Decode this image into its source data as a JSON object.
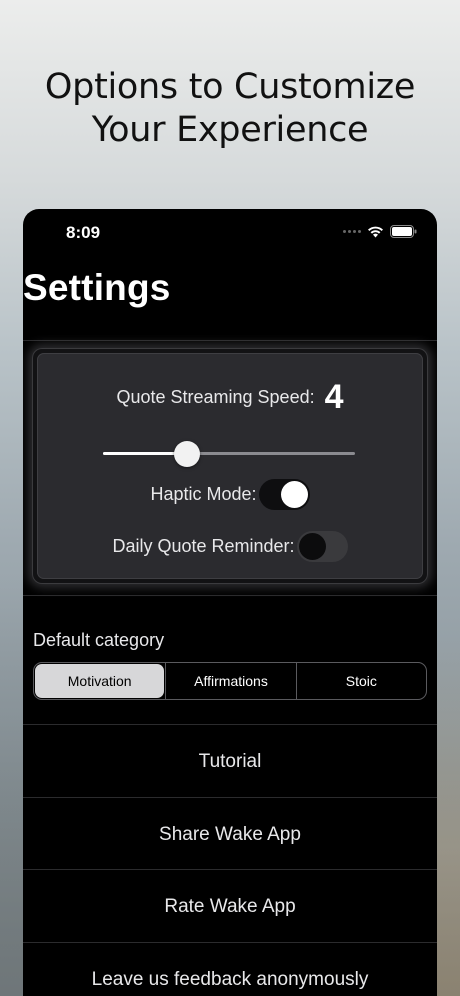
{
  "headline": {
    "line1": "Options to Customize",
    "line2": "Your Experience"
  },
  "status_bar": {
    "time": "8:09",
    "icons": [
      "signal-icon",
      "wifi-icon",
      "battery-icon"
    ]
  },
  "screen": {
    "title": "Settings"
  },
  "panel": {
    "speed_label": "Quote Streaming Speed:",
    "speed_value": "4",
    "speed_slider": {
      "min": 1,
      "max": 10,
      "value": 4
    },
    "haptic_label": "Haptic Mode:",
    "haptic_on": true,
    "reminder_label": "Daily Quote Reminder:",
    "reminder_on": false
  },
  "category": {
    "label": "Default category",
    "options": [
      "Motivation",
      "Affirmations",
      "Stoic"
    ],
    "selected": "Motivation"
  },
  "menu": {
    "tutorial": "Tutorial",
    "share": "Share Wake App",
    "rate": "Rate Wake App",
    "feedback": "Leave us feedback anonymously"
  },
  "colors": {
    "phone_background": "#000000",
    "panel_background": "#2b2b2f",
    "selected_segment": "#d7d7d9"
  }
}
